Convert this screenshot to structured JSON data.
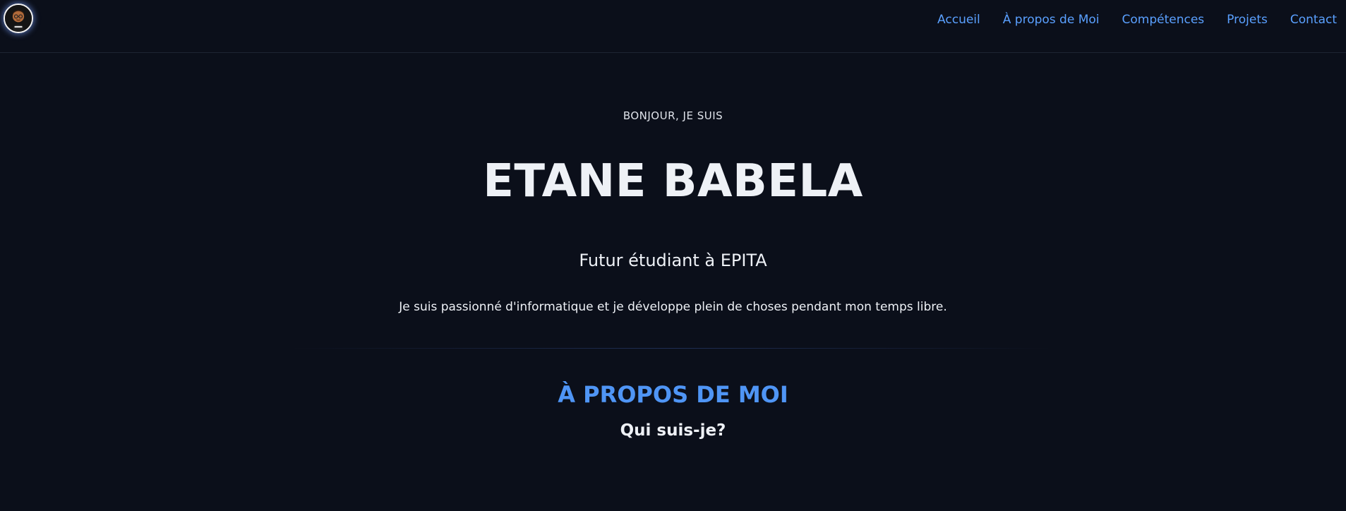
{
  "nav": {
    "logo_icon": "avatar-logo-icon",
    "links": [
      {
        "label": "Accueil"
      },
      {
        "label": "À propos de Moi"
      },
      {
        "label": "Compétences"
      },
      {
        "label": "Projets"
      },
      {
        "label": "Contact"
      }
    ]
  },
  "hero": {
    "greeting": "BONJOUR, JE SUIS",
    "name": "ETANE BABELA",
    "subtitle": "Futur étudiant à EPITA",
    "description": "Je suis passionné d'informatique et je développe plein de choses pendant mon temps libre."
  },
  "about": {
    "title": "À PROPOS DE MOI",
    "subtitle": "Qui suis-je?"
  },
  "colors": {
    "background": "#0b0f1a",
    "accent": "#5aa0ff",
    "text": "#eef1f6"
  }
}
